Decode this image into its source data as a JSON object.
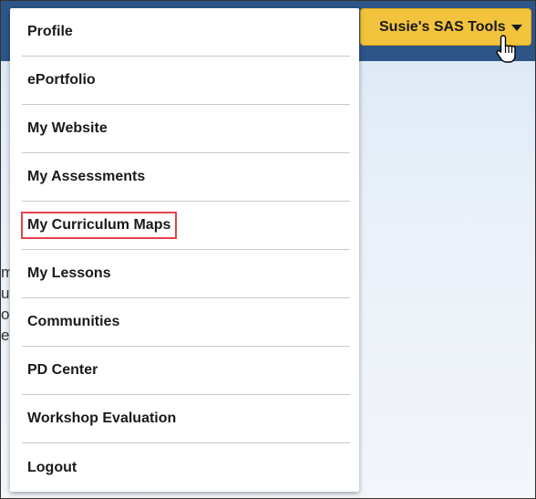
{
  "header": {
    "tools_button_label": "Susie's SAS Tools"
  },
  "background": {
    "partial_text": "m\nu\no\ne"
  },
  "menu": {
    "items": [
      {
        "label": "Profile"
      },
      {
        "label": "ePortfolio"
      },
      {
        "label": "My Website"
      },
      {
        "label": "My Assessments"
      },
      {
        "label": "My Curriculum Maps",
        "highlighted": true
      },
      {
        "label": "My Lessons"
      },
      {
        "label": "Communities"
      },
      {
        "label": "PD Center"
      },
      {
        "label": "Workshop Evaluation"
      },
      {
        "label": "Logout"
      }
    ]
  },
  "colors": {
    "topbar": "#2d5587",
    "tools_button": "#f2c33c",
    "highlight_border": "#e0444c"
  },
  "icons": {
    "caret": "caret-down-icon",
    "cursor": "hand-pointer-icon"
  }
}
